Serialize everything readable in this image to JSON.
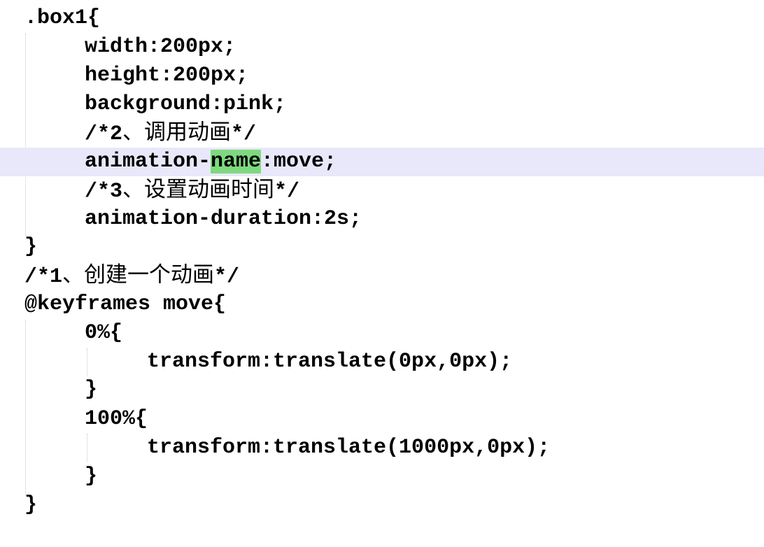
{
  "editor": {
    "lines": [
      {
        "text": ".box1{"
      },
      {
        "text": "width:200px;"
      },
      {
        "text": "height:200px;"
      },
      {
        "text": "background:pink;"
      },
      {
        "prefix": "/*2",
        "cjk": "、调用动画",
        "suffix": "*/"
      },
      {
        "before": "animation-",
        "match": "name",
        "after": ":move;"
      },
      {
        "prefix": "/*3",
        "cjk": "、设置动画时间",
        "suffix": "*/"
      },
      {
        "text": "animation-duration:2s;"
      },
      {
        "text": "}"
      },
      {
        "prefix": "/*1",
        "cjk": "、创建一个动画",
        "suffix": "*/"
      },
      {
        "text": "@keyframes move{"
      },
      {
        "text": "0%{"
      },
      {
        "text": "transform:translate(0px,0px);"
      },
      {
        "text": "}"
      },
      {
        "text": "100%{"
      },
      {
        "text": "transform:translate(1000px,0px);"
      },
      {
        "text": "}"
      },
      {
        "text": "}"
      }
    ],
    "current_line_color": "#e8e8fa",
    "match_highlight_color": "#7ed97e"
  }
}
